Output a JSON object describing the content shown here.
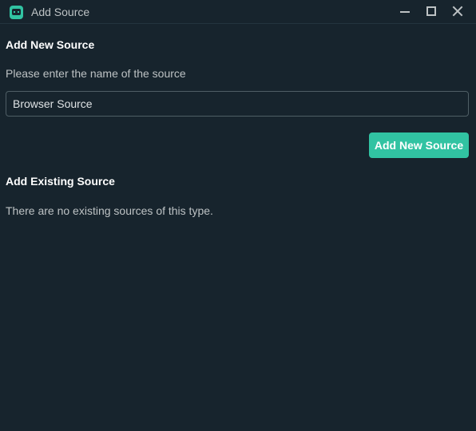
{
  "window": {
    "title": "Add Source",
    "icon": "streamlabs-robot-icon",
    "controls": [
      "minimize",
      "maximize",
      "close"
    ]
  },
  "new_source": {
    "heading": "Add New Source",
    "prompt": "Please enter the name of the source",
    "name_value": "Browser Source",
    "add_button_label": "Add New Source"
  },
  "existing_source": {
    "heading": "Add Existing Source",
    "empty_message": "There are no existing sources of this type."
  },
  "colors": {
    "background": "#17242d",
    "accent": "#31c3a2",
    "text_primary": "#ffffff",
    "text_secondary": "#bdc2c4",
    "input_border": "#4f5e65"
  }
}
